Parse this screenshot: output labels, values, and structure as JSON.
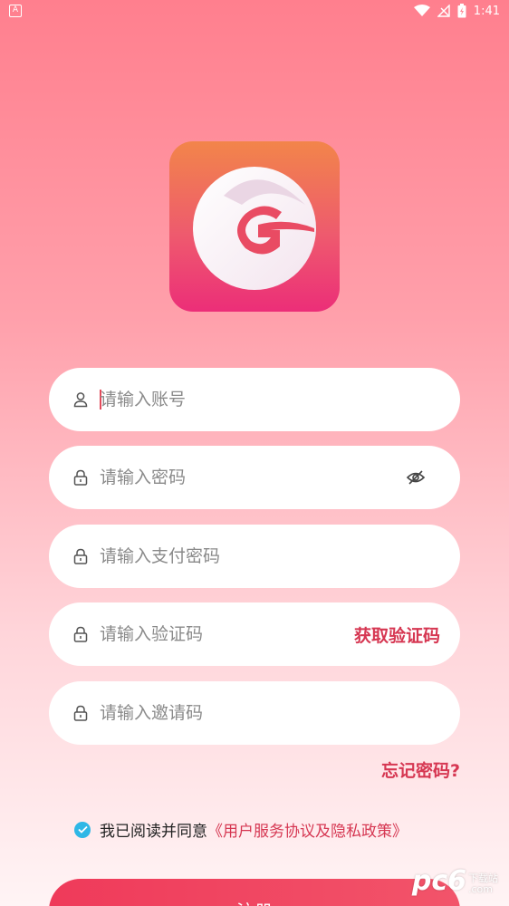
{
  "status_bar": {
    "time": "1:41",
    "left_icon": "A"
  },
  "colors": {
    "accent": "#d63752",
    "checkbox": "#2fb7e6",
    "button": "#ef3a5a"
  },
  "form": {
    "account": {
      "placeholder": "请输入账号",
      "icon": "user-icon"
    },
    "password": {
      "placeholder": "请输入密码",
      "icon": "lock-icon",
      "toggle_icon": "eye-off-icon"
    },
    "pay_password": {
      "placeholder": "请输入支付密码",
      "icon": "lock-icon"
    },
    "verify_code": {
      "placeholder": "请输入验证码",
      "icon": "lock-icon",
      "get_code_label": "获取验证码"
    },
    "invite_code": {
      "placeholder": "请输入邀请码",
      "icon": "lock-icon"
    }
  },
  "forgot_label": "忘记密码?",
  "agreement": {
    "checked": true,
    "text": "我已阅读并同意",
    "link": "《用户服务协议及隐私政策》"
  },
  "register_label": "注册",
  "watermark": {
    "logo_text": "pc6",
    "small_top": "下载站",
    "small_bottom": ".com"
  }
}
